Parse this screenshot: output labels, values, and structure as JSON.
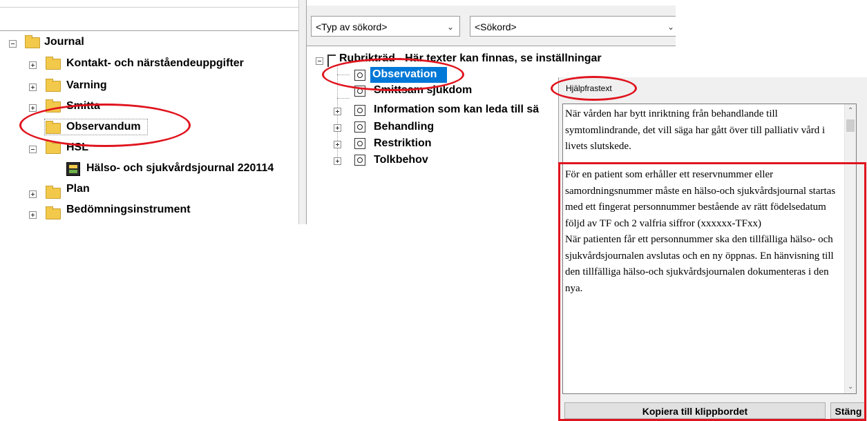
{
  "search": {
    "type_select_value": "<Typ av sökord>",
    "keyword_select_value": "<Sökord>"
  },
  "left_tree": {
    "root": "Journal",
    "items": [
      {
        "label": "Kontakt- och närståendeuppgifter"
      },
      {
        "label": "Varning"
      },
      {
        "label": "Smitta"
      },
      {
        "label": "Observandum"
      },
      {
        "label": "HSL"
      },
      {
        "label": "Hälso- och sjukvårdsjournal 220114"
      },
      {
        "label": "Plan"
      },
      {
        "label": "Bedömningsinstrument"
      }
    ]
  },
  "right_tree": {
    "root": "Rubrikträd - Här texter kan finnas, se inställningar",
    "items": [
      {
        "label": "Observation"
      },
      {
        "label": "Smittsam sjukdom"
      },
      {
        "label": "Information som kan leda till sä"
      },
      {
        "label": "Behandling"
      },
      {
        "label": "Restriktion"
      },
      {
        "label": "Tolkbehov"
      }
    ]
  },
  "help_panel": {
    "title": "Hjälpfrastext",
    "text_1": "När vården har bytt inriktning från behandlande till symtomlindrande, det vill säga har gått över till palliativ vård i livets slutskede.",
    "text_2": "För en patient som erhåller ett reservnummer eller samordningsnummer måste en hälso-och sjukvårdsjournal startas med ett fingerat personnummer bestående av rätt födelsedatum följd av TF och 2 valfria siffror (xxxxxx-TFxx)\nNär patienten får ett personnummer ska den tillfälliga hälso- och sjukvårdsjournalen avslutas och en ny öppnas. En hänvisning till den tillfälliga hälso-och sjukvårdsjournalen dokumenteras i den nya.",
    "copy_button": "Kopiera till klippbordet",
    "close_button": "Stäng"
  },
  "colors": {
    "annotation_red": "#e0141e",
    "selection_blue": "#0078d7",
    "folder_yellow": "#f2c94a"
  }
}
